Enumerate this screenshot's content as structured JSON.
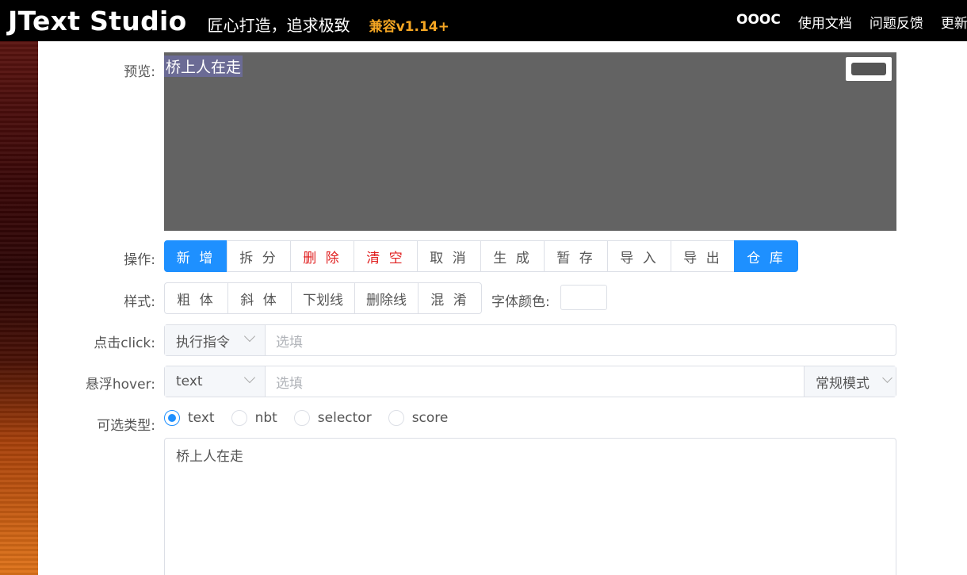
{
  "header": {
    "brand": "JText Studio",
    "slogan": "匠心打造，追求极致",
    "compat": "兼容v1.14+",
    "nav": [
      "OOOC",
      "使用文档",
      "问题反馈",
      "更新"
    ]
  },
  "preview": {
    "label": "预览:",
    "text": "桥上人在走"
  },
  "actions": {
    "label": "操作:",
    "buttons": [
      "新 增",
      "拆 分",
      "删 除",
      "清 空",
      "取 消",
      "生 成",
      "暂 存",
      "导 入",
      "导 出",
      "仓 库"
    ]
  },
  "styles": {
    "label": "样式:",
    "buttons": [
      "粗 体",
      "斜 体",
      "下划线",
      "删除线",
      "混 淆"
    ],
    "font_color_label": "字体颜色:"
  },
  "click": {
    "label": "点击click:",
    "select": "执行指令",
    "placeholder": "选填"
  },
  "hover": {
    "label": "悬浮hover:",
    "select": "text",
    "placeholder": "选填",
    "mode": "常规模式"
  },
  "types": {
    "label": "可选类型:",
    "options": [
      "text",
      "nbt",
      "selector",
      "score"
    ],
    "selected": "text"
  },
  "editor": {
    "text": "桥上人在走"
  },
  "colors": {
    "primary": "#1e90ff",
    "danger": "#e02020",
    "accent": "#f5a623"
  }
}
